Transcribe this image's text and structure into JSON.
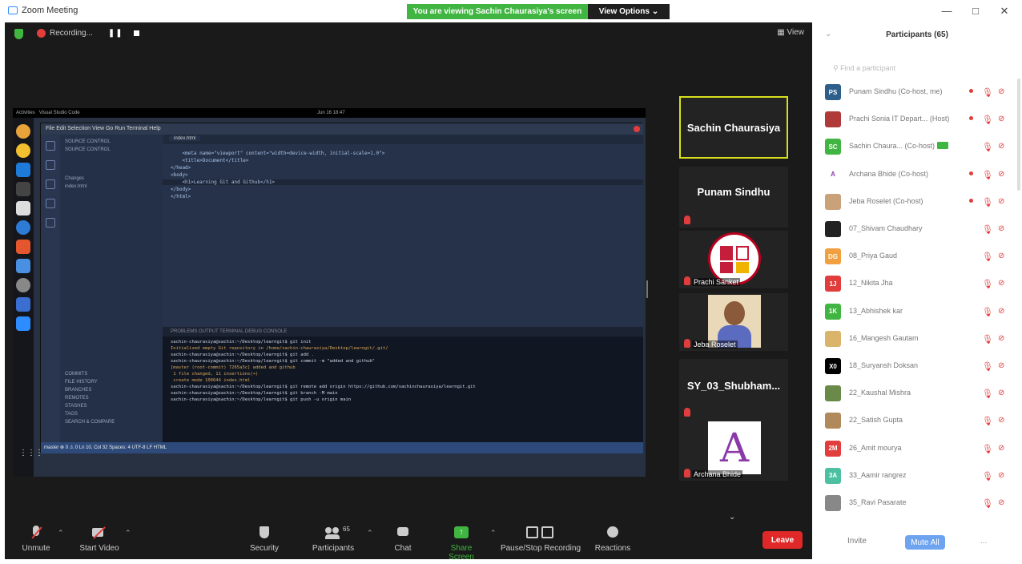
{
  "window": {
    "title": "Zoom Meeting",
    "banner": "You are viewing Sachin Chaurasiya's screen",
    "view_options": "View Options",
    "minimize": "—",
    "maximize": "□",
    "close": "✕"
  },
  "topbar": {
    "recording_label": "Recording...",
    "pause": "❚❚",
    "view_label": "View"
  },
  "shared_screen": {
    "activities": "Activities",
    "vscode_app": "Visual Studio Code",
    "clock": "Jun 16 18:47",
    "menu": "File  Edit  Selection  View  Go  Run  Terminal  Help",
    "tab": "index.html",
    "sidebar_lines": [
      "SOURCE CONTROL",
      "SOURCE CONTROL",
      "Changes",
      "index.html",
      "COMMITS",
      "FILE HISTORY",
      "BRANCHES",
      "REMOTES",
      "STASHES",
      "TAGS",
      "SEARCH & COMPARE"
    ],
    "code_lines": [
      "    <meta name=\"viewport\" content=\"width=device-width, initial-scale=1.0\">",
      "    <title>Document</title>",
      "</head>",
      "<body>",
      "    <h1>Learning Git and Github</h1>",
      "</body>",
      "</html>"
    ],
    "terminal_tabs": "PROBLEMS    OUTPUT    TERMINAL    DEBUG CONSOLE",
    "terminal_lines": [
      {
        "t": "sachin-chaurasiya@sachin:~/Desktop/learngit$ git init",
        "c": "#cfd6e6"
      },
      {
        "t": "Initialized empty Git repository in /home/sachin-chaurasiya/Desktop/learngit/.git/",
        "c": "#d9a55b"
      },
      {
        "t": "sachin-chaurasiya@sachin:~/Desktop/learngit$ git add .",
        "c": "#cfd6e6"
      },
      {
        "t": "sachin-chaurasiya@sachin:~/Desktop/learngit$ git commit -m \"added and github\"",
        "c": "#cfd6e6"
      },
      {
        "t": "[master (root-commit) 7265a3c] added and github",
        "c": "#d9a55b"
      },
      {
        "t": " 1 file changed, 11 insertions(+)",
        "c": "#d9a55b"
      },
      {
        "t": " create mode 100644 index.html",
        "c": "#d9a55b"
      },
      {
        "t": "sachin-chaurasiya@sachin:~/Desktop/learngit$ git remote add origin https://github.com/sachinchaurasiya/learngit.git",
        "c": "#cfd6e6"
      },
      {
        "t": "sachin-chaurasiya@sachin:~/Desktop/learngit$ git branch -M main",
        "c": "#cfd6e6"
      },
      {
        "t": "sachin-chaurasiya@sachin:~/Desktop/learngit$ git push -u origin main",
        "c": "#cfd6e6"
      }
    ],
    "statusbar": "master   ⊗ 0  ⚠ 0          Ln 10, Col 32   Spaces: 4   UTF-8   LF   HTML"
  },
  "tiles": [
    {
      "name": "Sachin Chaurasiya",
      "label": "",
      "active": true
    },
    {
      "name": "Punam Sindhu",
      "label": ""
    },
    {
      "name": "",
      "label": "Prachi Sanket"
    },
    {
      "name": "",
      "label": "Jeba Roselet"
    },
    {
      "name": "SY_03_Shubham...",
      "label": ""
    },
    {
      "name": "",
      "label": "Archana Bhide"
    }
  ],
  "toolbar": {
    "unmute": "Unmute",
    "start_video": "Start Video",
    "security": "Security",
    "participants": "Participants",
    "participants_count": "65",
    "chat": "Chat",
    "share_screen": "Share Screen",
    "pause_recording": "Pause/Stop Recording",
    "reactions": "Reactions",
    "leave": "Leave"
  },
  "panel": {
    "title": "Participants (65)",
    "search_placeholder": "Find a participant",
    "participants": [
      {
        "initials": "PS",
        "name": "Punam Sindhu (Co-host, me)",
        "color": "#2d5f8a",
        "dot": true
      },
      {
        "initials": "",
        "name": "Prachi Sonia IT Depart... (Host)",
        "color": "#b03a3a",
        "dot": true
      },
      {
        "initials": "SC",
        "name": "Sachin Chaura... (Co-host)",
        "color": "#41b541",
        "dot": false,
        "sharing": true
      },
      {
        "initials": "A",
        "name": "Archana Bhide (Co-host)",
        "color": "#ffffff",
        "text": "#8a3aa8",
        "dot": true
      },
      {
        "initials": "",
        "name": "Jeba Roselet (Co-host)",
        "color": "#c9a27a",
        "dot": true
      },
      {
        "initials": "",
        "name": "07_Shivam Chaudhary",
        "color": "#222222",
        "dot": false
      },
      {
        "initials": "DG",
        "name": "08_Priya Gaud",
        "color": "#f0a040",
        "dot": false
      },
      {
        "initials": "1J",
        "name": "12_Nikita Jha",
        "color": "#e23d3d",
        "dot": false
      },
      {
        "initials": "1K",
        "name": "13_Abhishek kar",
        "color": "#41b541",
        "dot": false
      },
      {
        "initials": "",
        "name": "16_Mangesh Gautam",
        "color": "#d9b46a",
        "dot": false
      },
      {
        "initials": "X0",
        "name": "18_Suryansh Doksan",
        "color": "#000000",
        "dot": false
      },
      {
        "initials": "",
        "name": "22_Kaushal Mishra",
        "color": "#6a8a4a",
        "dot": false
      },
      {
        "initials": "",
        "name": "22_Satish Gupta",
        "color": "#b08a5a",
        "dot": false
      },
      {
        "initials": "2M",
        "name": "26_Amit mourya",
        "color": "#e23d3d",
        "dot": false
      },
      {
        "initials": "3A",
        "name": "33_Aamir rangrez",
        "color": "#4cc0a0",
        "dot": false
      },
      {
        "initials": "",
        "name": "35_Ravi Pasarate",
        "color": "#888888",
        "dot": false
      }
    ],
    "invite": "Invite",
    "mute_all": "Mute All",
    "more": "..."
  }
}
